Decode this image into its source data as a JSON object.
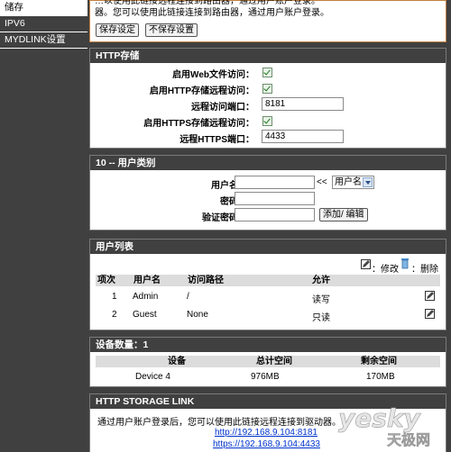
{
  "sidebar": {
    "items": [
      {
        "label": "储存",
        "active": true
      },
      {
        "label": "IPV6",
        "active": false
      },
      {
        "label": "MYDLINK设置",
        "active": false
      }
    ]
  },
  "top": {
    "notice_line1": "…以使用此链接远程连接到路由器，通过用户账户登录。",
    "notice_line2": "器。您可以使用此链接连接到路由器，通过用户账户登录。",
    "save_label": "保存设定",
    "nosave_label": "不保存设置"
  },
  "http_storage": {
    "title": "HTTP存储",
    "enable_web_label": "启用Web文件访问：",
    "enable_remote_label": "启用HTTP存储远程访问：",
    "remote_port_label": "远程访问端口：",
    "remote_port_value": "8181",
    "enable_https_label": "启用HTTPS存储远程访问：",
    "https_port_label": "远程HTTPS端口：",
    "https_port_value": "4433"
  },
  "user_type": {
    "title": "10 -- 用户类别",
    "username_label": "用户名：",
    "arrows": "<<",
    "select_value": "用户名",
    "password_label": "密码：",
    "confirm_label": "验证密码：",
    "add_edit_label": "添加/ 编辑"
  },
  "user_list": {
    "title": "用户列表",
    "edit_legend": "：修改",
    "delete_legend": "：删除",
    "headers": [
      "项次",
      "用户名",
      "访问路径",
      "允许"
    ],
    "rows": [
      {
        "no": "1",
        "user": "Admin",
        "path": "/",
        "perm": "读写"
      },
      {
        "no": "2",
        "user": "Guest",
        "path": "None",
        "perm": "只读"
      }
    ]
  },
  "devices": {
    "title": "设备数量：1",
    "headers": [
      "设备",
      "总计空间",
      "剩余空间"
    ],
    "rows": [
      {
        "device": "Device 4",
        "total": "976MB",
        "free": "170MB"
      }
    ]
  },
  "storage_link": {
    "title": "HTTP STORAGE LINK",
    "desc": "通过用户账户登录后，您可以使用此链接远程连接到驱动器。",
    "http_link": "http://192.168.9.104:8181",
    "https_link": "https://192.168.9.104:4433"
  },
  "watermark": {
    "brand": "yesky",
    "cn": "天极网"
  },
  "colors": {
    "header_bg": "#404040",
    "body_bg": "#ffffff",
    "accent_border": "#c08040",
    "link": "#0033cc"
  }
}
